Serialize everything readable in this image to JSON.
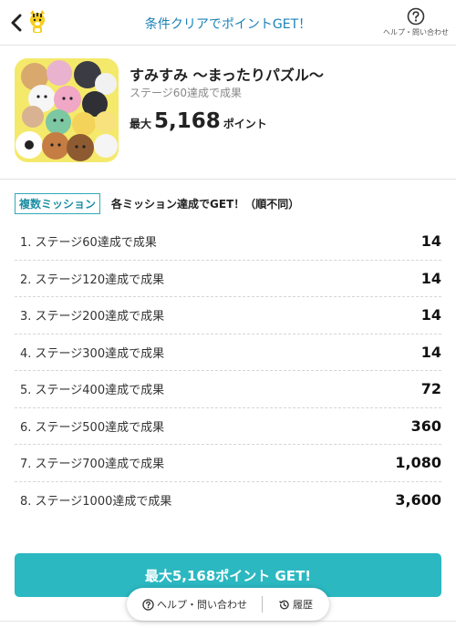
{
  "header": {
    "title": "条件クリアでポイントGET！",
    "help_label": "ヘルプ・問い合わせ"
  },
  "app": {
    "name": "すみすみ 〜まったりパズル〜",
    "condition": "ステージ60達成で成果",
    "max_prefix": "最大",
    "max_points": "5,168",
    "max_suffix": "ポイント"
  },
  "missions": {
    "tag": "複数ミッション",
    "description": "各ミッション達成でGET！（順不同）",
    "items": [
      {
        "label": "1. ステージ60達成で成果",
        "points": "14"
      },
      {
        "label": "2. ステージ120達成で成果",
        "points": "14"
      },
      {
        "label": "3. ステージ200達成で成果",
        "points": "14"
      },
      {
        "label": "4. ステージ300達成で成果",
        "points": "14"
      },
      {
        "label": "5. ステージ400達成で成果",
        "points": "72"
      },
      {
        "label": "6. ステージ500達成で成果",
        "points": "360"
      },
      {
        "label": "7. ステージ700達成で成果",
        "points": "1,080"
      },
      {
        "label": "8. ステージ1000達成で成果",
        "points": "3,600"
      }
    ]
  },
  "cta": {
    "label": "最大5,168ポイント GET!"
  },
  "footer_pill": {
    "help_label": "ヘルプ・問い合わせ",
    "history_label": "履歴"
  },
  "colors": {
    "accent": "#2bb8c1",
    "title_blue": "#1a82b8",
    "tag_border": "#31a9b8",
    "icon_bg": "#f4e96a"
  },
  "icons": [
    "chevron-left-icon",
    "tiger-logo-icon",
    "question-circle-icon",
    "history-icon"
  ]
}
